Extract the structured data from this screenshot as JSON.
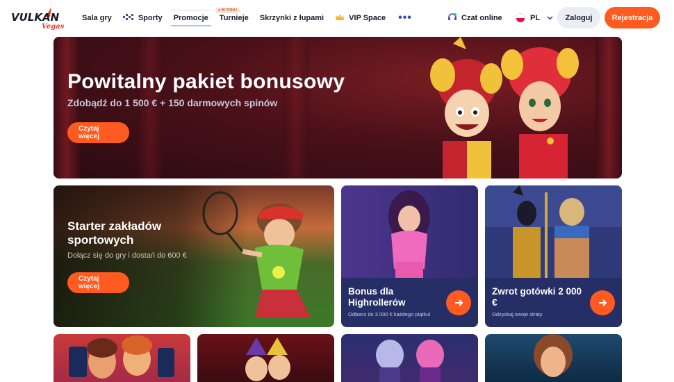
{
  "brand": {
    "logo_text": "VULKAN",
    "logo_sub": "Vegas",
    "accent": "#ff5a1f"
  },
  "nav": {
    "items": [
      {
        "label": "Sala gry",
        "icon": ""
      },
      {
        "label": "Sporty",
        "icon": "football-icon"
      },
      {
        "label": "Promocje",
        "icon": "",
        "active": true
      },
      {
        "label": "Turnieje",
        "icon": "",
        "badge": "● W TOKU"
      },
      {
        "label": "Skrzynki z łupami",
        "icon": ""
      },
      {
        "label": "VIP Space",
        "icon": "crown-icon"
      }
    ],
    "more": "•••"
  },
  "header_right": {
    "chat_label": "Czat online",
    "lang_label": "PL",
    "login_label": "Zaloguj",
    "register_label": "Rejestracja"
  },
  "hero": {
    "title": "Powitalny pakiet bonusowy",
    "subtitle": "Zdobądź do 1 500 € + 150 darmowych spinów",
    "cta": "Czytaj więcej"
  },
  "promo_sport": {
    "title": "Starter zakładów sportowych",
    "desc": "Dołącz się do gry i dostań do 600 €",
    "cta": "Czytaj więcej"
  },
  "promo_highroller": {
    "title": "Bonus dla Highrollerów",
    "desc": "Odbierz do 3 000 € każdego piątku!"
  },
  "promo_cashback": {
    "title": "Zwrot gotówki 2 000 €",
    "desc": "Odzyskaj swoje straty"
  }
}
